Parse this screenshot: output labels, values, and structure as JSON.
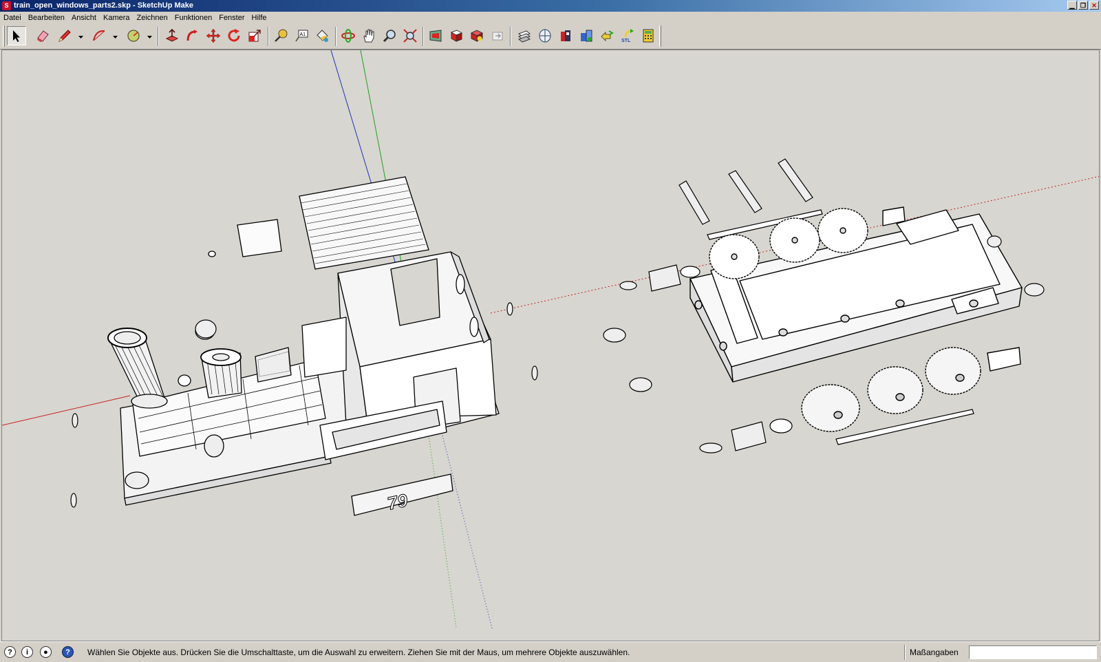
{
  "window": {
    "title": "train_open_windows_parts2.skp - SketchUp Make",
    "buttons": [
      "minimize",
      "maximize",
      "close"
    ]
  },
  "menu": [
    "Datei",
    "Bearbeiten",
    "Ansicht",
    "Kamera",
    "Zeichnen",
    "Funktionen",
    "Fenster",
    "Hilfe"
  ],
  "toolbar": {
    "tools": [
      {
        "name": "select-tool-icon",
        "active": true
      },
      {
        "name": "eraser-tool-icon"
      },
      {
        "name": "pencil-line-tool-icon"
      },
      {
        "name": "arc-tool-icon"
      },
      {
        "name": "polygon-tool-icon"
      },
      {
        "name": "push-pull-tool-icon"
      },
      {
        "name": "follow-me-tool-icon"
      },
      {
        "name": "move-tool-icon"
      },
      {
        "name": "rotate-tool-icon"
      },
      {
        "name": "scale-tool-icon"
      },
      {
        "name": "tape-measure-tool-icon"
      },
      {
        "name": "text-tool-icon"
      },
      {
        "name": "paint-bucket-tool-icon"
      },
      {
        "name": "orbit-tool-icon"
      },
      {
        "name": "pan-tool-icon"
      },
      {
        "name": "zoom-tool-icon"
      },
      {
        "name": "zoom-extents-tool-icon"
      },
      {
        "name": "warehouse-icon"
      },
      {
        "name": "share-model-icon"
      },
      {
        "name": "components-icon"
      },
      {
        "name": "extension-warehouse-icon"
      },
      {
        "name": "section-plane-icon"
      },
      {
        "name": "cube-view-icon"
      },
      {
        "name": "import-icon"
      },
      {
        "name": "solid-inspector-icon"
      },
      {
        "name": "export-arrow-icon"
      },
      {
        "name": "stl-export-icon"
      },
      {
        "name": "calculator-icon"
      }
    ],
    "text_tool_label": "A1",
    "stl_label": "STL"
  },
  "viewport": {
    "model_label": "79"
  },
  "statusbar": {
    "message": "Wählen Sie Objekte aus. Drücken Sie die Umschalttaste, um die Auswahl zu erweitern. Ziehen Sie mit der Maus, um mehrere Objekte auszuwählen.",
    "measure_label": "Maßangaben",
    "measure_value": "",
    "icons": [
      "geo-location-icon",
      "credits-icon",
      "user-account-icon",
      "help-icon"
    ]
  },
  "colors": {
    "title_gradient_start": "#0a246a",
    "chrome": "#d4d0c8",
    "viewport_bg": "#d7d6d0",
    "axis_red": "#cc2020",
    "axis_green": "#20a020",
    "axis_blue": "#2030c0"
  }
}
